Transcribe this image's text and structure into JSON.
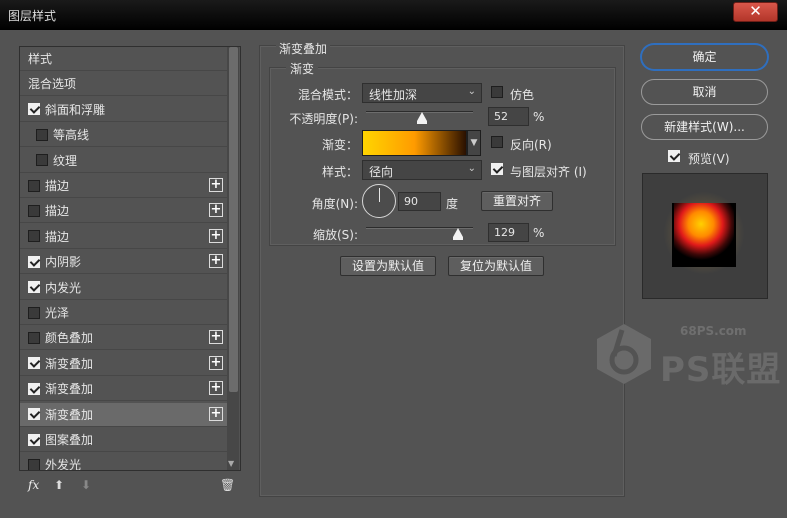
{
  "window": {
    "title": "图层样式",
    "close_icon": "close-icon"
  },
  "styles_list": {
    "items": [
      {
        "label": "样式",
        "checkbox": false,
        "checked": false,
        "plus": false,
        "indent": false,
        "selected": false
      },
      {
        "label": "混合选项",
        "checkbox": false,
        "checked": false,
        "plus": false,
        "indent": false,
        "selected": false
      },
      {
        "label": "斜面和浮雕",
        "checkbox": true,
        "checked": true,
        "plus": false,
        "indent": false,
        "selected": false
      },
      {
        "label": "等高线",
        "checkbox": true,
        "checked": false,
        "plus": false,
        "indent": true,
        "selected": false
      },
      {
        "label": "纹理",
        "checkbox": true,
        "checked": false,
        "plus": false,
        "indent": true,
        "selected": false
      },
      {
        "label": "描边",
        "checkbox": true,
        "checked": false,
        "plus": true,
        "indent": false,
        "selected": false
      },
      {
        "label": "描边",
        "checkbox": true,
        "checked": false,
        "plus": true,
        "indent": false,
        "selected": false
      },
      {
        "label": "描边",
        "checkbox": true,
        "checked": false,
        "plus": true,
        "indent": false,
        "selected": false
      },
      {
        "label": "内阴影",
        "checkbox": true,
        "checked": true,
        "plus": true,
        "indent": false,
        "selected": false
      },
      {
        "label": "内发光",
        "checkbox": true,
        "checked": true,
        "plus": false,
        "indent": false,
        "selected": false
      },
      {
        "label": "光泽",
        "checkbox": true,
        "checked": false,
        "plus": false,
        "indent": false,
        "selected": false
      },
      {
        "label": "颜色叠加",
        "checkbox": true,
        "checked": false,
        "plus": true,
        "indent": false,
        "selected": false
      },
      {
        "label": "渐变叠加",
        "checkbox": true,
        "checked": true,
        "plus": true,
        "indent": false,
        "selected": false
      },
      {
        "label": "渐变叠加",
        "checkbox": true,
        "checked": true,
        "plus": true,
        "indent": false,
        "selected": false
      },
      {
        "label": "渐变叠加",
        "checkbox": true,
        "checked": true,
        "plus": true,
        "indent": false,
        "selected": true
      },
      {
        "label": "图案叠加",
        "checkbox": true,
        "checked": true,
        "plus": false,
        "indent": false,
        "selected": false
      },
      {
        "label": "外发光",
        "checkbox": true,
        "checked": false,
        "plus": false,
        "indent": false,
        "selected": false
      }
    ],
    "plus_symbol": "+",
    "tools": {
      "fx": "fx",
      "up": "⬆",
      "down": "⬇",
      "trash": "🗑"
    }
  },
  "gradient_overlay": {
    "group_title": "渐变叠加",
    "sub_title": "渐变",
    "blend_mode_label": "混合模式：",
    "blend_mode_value": "线性加深",
    "dither_label": "仿色",
    "dither_checked": false,
    "opacity_label": "不透明度(P):",
    "opacity_value": "52",
    "opacity_fraction": 0.52,
    "percent": "%",
    "gradient_label": "渐变：",
    "gradient_colors": [
      "#ffd500",
      "#ff9b00",
      "#2a1000"
    ],
    "reverse_label": "反向(R)",
    "reverse_checked": false,
    "style_label": "样式：",
    "style_value": "径向",
    "align_label": "与图层对齐 (I)",
    "align_checked": true,
    "angle_label": "角度(N):",
    "angle_value": "90",
    "degree_unit": "度",
    "reset_align_button": "重置对齐",
    "scale_label": "缩放(S):",
    "scale_value": "129",
    "scale_fraction": 0.86,
    "set_default_button": "设置为默认值",
    "reset_default_button": "复位为默认值"
  },
  "right_panel": {
    "ok_button": "确定",
    "cancel_button": "取消",
    "new_style_button": "新建样式(W)...",
    "preview_label": "预览(V)",
    "preview_checked": true
  },
  "watermark": {
    "site": "68PS.com",
    "text": "PS联盟"
  }
}
